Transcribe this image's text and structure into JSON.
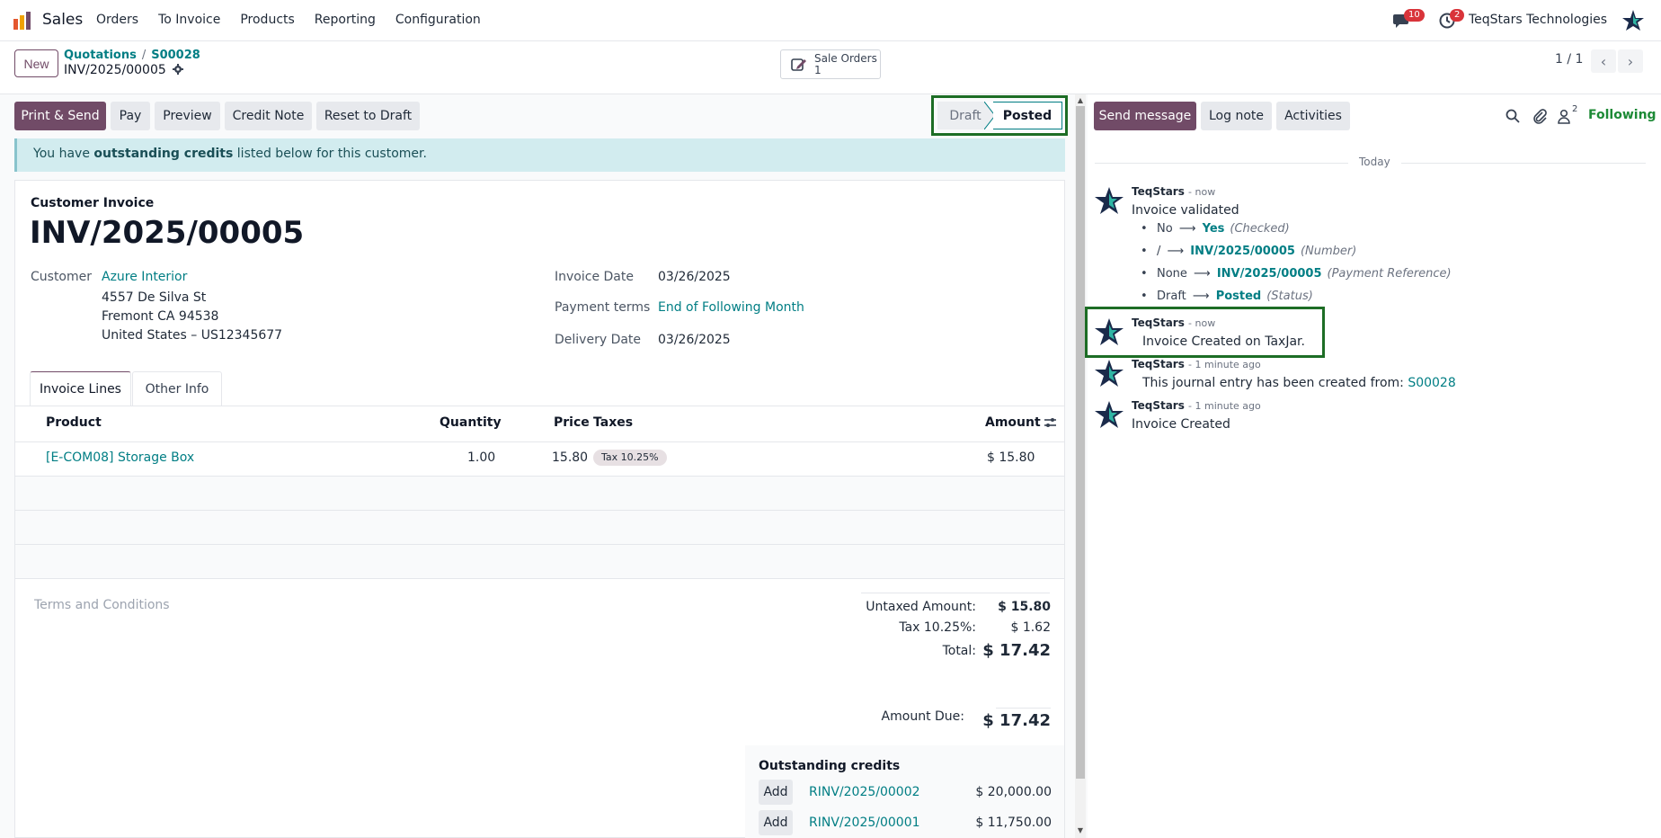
{
  "navbar": {
    "app_name": "Sales",
    "menu": [
      "Orders",
      "To Invoice",
      "Products",
      "Reporting",
      "Configuration"
    ],
    "chat_badge": "10",
    "activity_badge": "2",
    "company": "TeqStars Technologies"
  },
  "control_panel": {
    "new_label": "New",
    "breadcrumb": [
      "Quotations",
      "S00028"
    ],
    "record_name": "INV/2025/00005",
    "smart_button": {
      "label": "Sale Orders",
      "count": "1"
    },
    "pager": "1 / 1"
  },
  "actions": {
    "print_send": "Print & Send",
    "pay": "Pay",
    "preview": "Preview",
    "credit_note": "Credit Note",
    "reset_to_draft": "Reset to Draft"
  },
  "statusbar": {
    "draft": "Draft",
    "posted": "Posted"
  },
  "alert": {
    "prefix": "You have ",
    "bold": "outstanding credits",
    "suffix": " listed below for this customer."
  },
  "invoice": {
    "type": "Customer Invoice",
    "number": "INV/2025/00005",
    "customer_label": "Customer",
    "customer_name": "Azure Interior",
    "address": [
      "4557 De Silva St",
      "Fremont CA 94538",
      "United States – US12345677"
    ],
    "invoice_date_label": "Invoice Date",
    "invoice_date": "03/26/2025",
    "payment_terms_label": "Payment terms",
    "payment_terms": "End of Following Month",
    "delivery_date_label": "Delivery Date",
    "delivery_date": "03/26/2025"
  },
  "tabs": [
    "Invoice Lines",
    "Other Info"
  ],
  "lines": {
    "headers": {
      "product": "Product",
      "quantity": "Quantity",
      "price": "Price",
      "taxes": "Taxes",
      "amount": "Amount"
    },
    "rows": [
      {
        "product": "[E-COM08] Storage Box",
        "quantity": "1.00",
        "price": "15.80",
        "tax": "Tax 10.25%",
        "amount": "$ 15.80"
      }
    ]
  },
  "terms_placeholder": "Terms and Conditions",
  "totals": {
    "untaxed_label": "Untaxed Amount:",
    "untaxed": "$ 15.80",
    "tax_label": "Tax 10.25%:",
    "tax": "$ 1.62",
    "total_label": "Total:",
    "total": "$ 17.42",
    "due_label": "Amount Due:",
    "due": "$ 17.42"
  },
  "outstanding_credits": {
    "title": "Outstanding credits",
    "add_label": "Add",
    "items": [
      {
        "ref": "RINV/2025/00002",
        "amount": "$ 20,000.00"
      },
      {
        "ref": "RINV/2025/00001",
        "amount": "$ 11,750.00"
      }
    ]
  },
  "chatter": {
    "send_message": "Send message",
    "log_note": "Log note",
    "activities": "Activities",
    "followers_count": "2",
    "following": "Following",
    "date_separator": "Today",
    "messages": [
      {
        "author": "TeqStars",
        "time": "- now",
        "body": "Invoice validated",
        "tracking": [
          {
            "old": "No",
            "new": "Yes",
            "field": "(Checked)"
          },
          {
            "old": "/",
            "new": "INV/2025/00005",
            "field": "(Number)"
          },
          {
            "old": "None",
            "new": "INV/2025/00005",
            "field": "(Payment Reference)"
          },
          {
            "old": "Draft",
            "new": "Posted",
            "field": "(Status)"
          }
        ]
      },
      {
        "author": "TeqStars",
        "time": "- now",
        "body": "Invoice Created on TaxJar."
      },
      {
        "author": "TeqStars",
        "time": "- 1 minute ago",
        "body": "This journal entry has been created from: ",
        "link": "S00028"
      },
      {
        "author": "TeqStars",
        "time": "- 1 minute ago",
        "body": "Invoice Created"
      }
    ]
  },
  "colors": {
    "brand": "#714b67",
    "link": "#017e84",
    "highlight_box": "#1d6d25",
    "badge": "#d9343a"
  }
}
